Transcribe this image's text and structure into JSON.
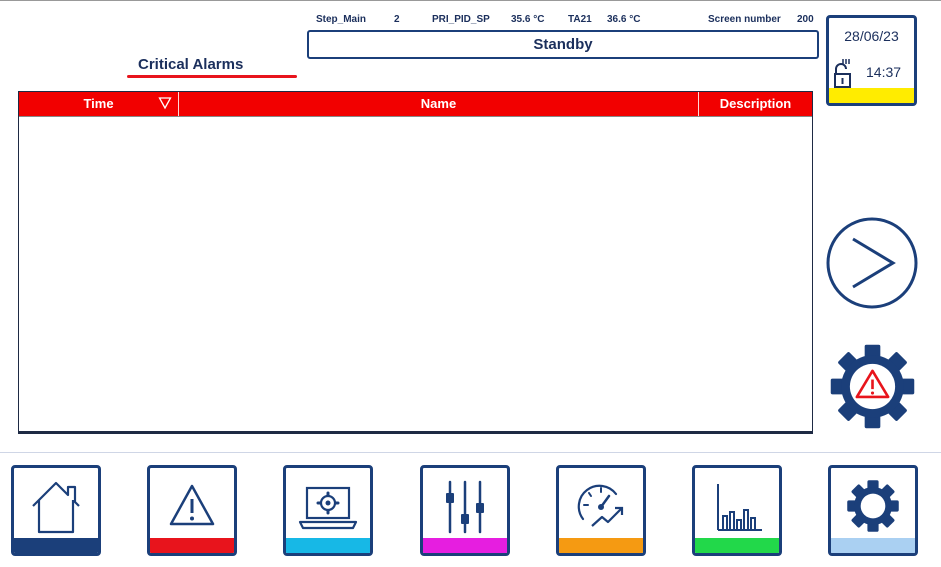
{
  "header": {
    "step_label": "Step_Main",
    "step_value": "2",
    "pid_label": "PRI_PID_SP",
    "pid_value": "35.6 °C",
    "ta_label": "TA21",
    "ta_value": "36.6 °C",
    "screen_label": "Screen number",
    "screen_value": "200",
    "state": "Standby"
  },
  "page": {
    "title": "Critical Alarms"
  },
  "datetime": {
    "date": "28/06/23",
    "time": "14:37",
    "bar_color": "#ffec00"
  },
  "table": {
    "columns": [
      "Time",
      "Name",
      "Description"
    ],
    "rows": []
  },
  "colors": {
    "navy": "#1b3f7a",
    "header_red": "#f20000",
    "accent_red": "#e8141c"
  },
  "nav": [
    {
      "icon": "home-icon",
      "bar_color": "#1b3f7a"
    },
    {
      "icon": "warning-icon",
      "bar_color": "#e8141c"
    },
    {
      "icon": "laptop-gear-icon",
      "bar_color": "#17b8e6"
    },
    {
      "icon": "sliders-icon",
      "bar_color": "#e61ee0"
    },
    {
      "icon": "speedometer-icon",
      "bar_color": "#f59a12"
    },
    {
      "icon": "bar-chart-icon",
      "bar_color": "#22d84a"
    },
    {
      "icon": "gear-icon",
      "bar_color": "#aad0f2"
    }
  ]
}
